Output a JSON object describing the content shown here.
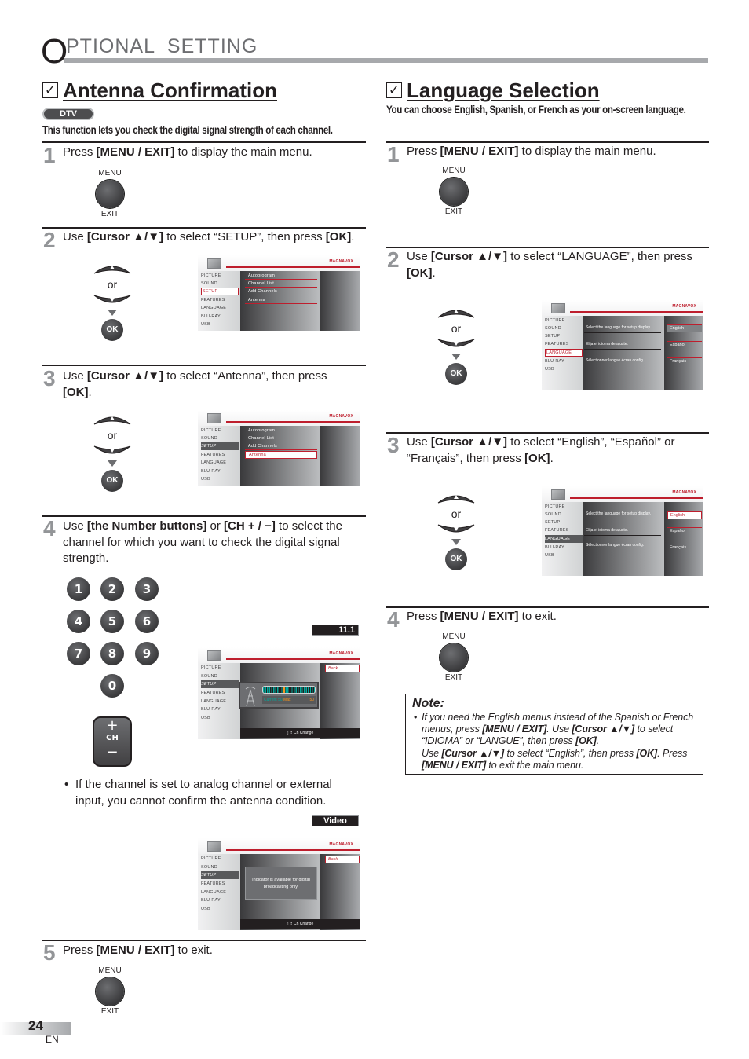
{
  "header": {
    "title_initial": "O",
    "title_rest": "PTIONAL  SETTING"
  },
  "antenna": {
    "title": "Antenna Confirmation",
    "badge": "DTV",
    "intro": "This function lets you check the digital signal strength of each channel.",
    "steps": [
      {
        "num": "1",
        "pre": "Press ",
        "bold1": "[MENU / EXIT]",
        "post": " to display the main menu."
      },
      {
        "num": "2",
        "pre": "Use ",
        "bold1": "[Cursor ▲/▼]",
        "post": " to select “SETUP”, then press ",
        "bold2": "[OK]",
        "end": "."
      },
      {
        "num": "3",
        "pre": "Use ",
        "bold1": "[Cursor ▲/▼]",
        "post": " to select “Antenna”, then press ",
        "bold2": "[OK]",
        "end": "."
      },
      {
        "num": "4",
        "pre": "Use ",
        "bold1": "[the Number buttons]",
        "mid": " or ",
        "bold2": "[CH + / −]",
        "post": " to select the channel for which you want to check the digital signal strength."
      },
      {
        "num": "5",
        "pre": "Press ",
        "bold1": "[MENU / EXIT]",
        "post": " to exit."
      }
    ],
    "bullet": "If the channel is set to analog channel or external input, you cannot confirm the antenna condition.",
    "channel_display": "11.1",
    "input_display": "Video",
    "signal": {
      "current_label": "Current",
      "current": "50",
      "max_label": "Max",
      "max": "50",
      "level_fraction": 0.4
    },
    "na_message": "Indicator is available for digital broadcasting only.",
    "ch_change": "Ch Change",
    "back": "Back"
  },
  "language": {
    "title": "Language Selection",
    "intro": "You can choose English, Spanish, or French as your on-screen language.",
    "steps": [
      {
        "num": "1",
        "pre": "Press ",
        "bold1": "[MENU / EXIT]",
        "post": " to display the main menu."
      },
      {
        "num": "2",
        "pre": "Use ",
        "bold1": "[Cursor ▲/▼]",
        "post": " to select “LANGUAGE”, then press ",
        "bold2": "[OK]",
        "end": "."
      },
      {
        "num": "3",
        "pre": "Use ",
        "bold1": "[Cursor ▲/▼]",
        "post": " to select “English”, “Español” or “Français”, then press ",
        "bold2": "[OK]",
        "end": "."
      },
      {
        "num": "4",
        "pre": "Press ",
        "bold1": "[MENU / EXIT]",
        "post": " to exit."
      }
    ],
    "descriptions": [
      "Select the language for setup display.",
      "Elija el idioma de ajuste.",
      "Sélectionner langue écran config."
    ],
    "options": [
      "English",
      "Español",
      "Français"
    ]
  },
  "note": {
    "title": "Note:",
    "line1_a": "If you need the English menus instead of the Spanish or French menus, press ",
    "line1_b": "[MENU / EXIT]",
    "line1_c": ". Use ",
    "line1_d": "[Cursor ▲/▼]",
    "line1_e": " to select “IDIOMA” or “LANGUE”, then press ",
    "line1_f": "[OK]",
    "line1_g": ".",
    "line2_a": "Use ",
    "line2_b": "[Cursor ▲/▼]",
    "line2_c": " to select “English”, then press ",
    "line2_d": "[OK]",
    "line2_e": ". Press ",
    "line2_f": "[MENU / EXIT]",
    "line2_g": " to exit the main menu."
  },
  "remote": {
    "menu_top": "MENU",
    "menu_bottom": "EXIT",
    "or": "or",
    "ok": "OK",
    "numbers": [
      "1",
      "2",
      "3",
      "4",
      "5",
      "6",
      "7",
      "8",
      "9",
      "0"
    ],
    "ch_plus": "+",
    "ch_label": "CH",
    "ch_minus": "−"
  },
  "tv_menu": {
    "brand": "MAGNAVOX",
    "main": [
      "PICTURE",
      "SOUND",
      "SETUP",
      "FEATURES",
      "LANGUAGE",
      "BLU-RAY",
      "USB"
    ],
    "setup_sub": [
      "Autoprogram",
      "Channel List",
      "Add Channels",
      "Antenna"
    ]
  },
  "footer": {
    "page": "24",
    "lang": "EN"
  }
}
